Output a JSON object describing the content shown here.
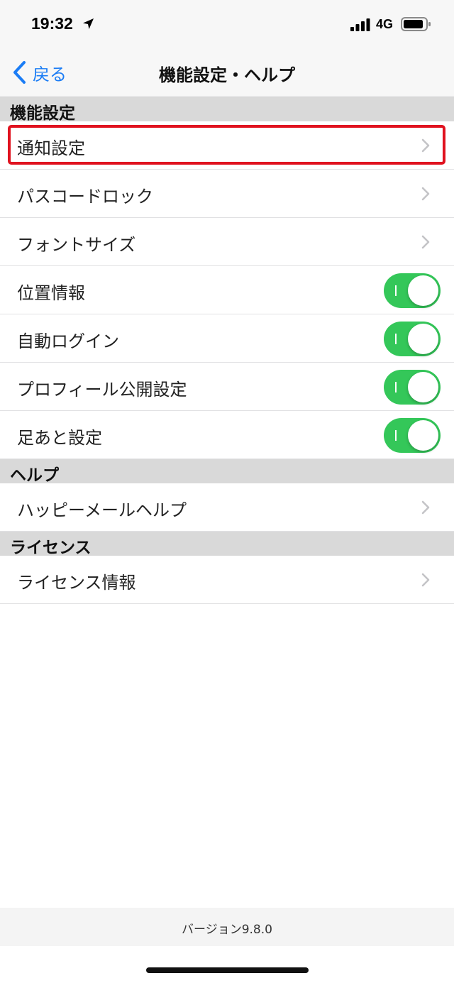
{
  "status_bar": {
    "time": "19:32",
    "network": "4G"
  },
  "nav": {
    "back_label": "戻る",
    "title": "機能設定・ヘルプ"
  },
  "sections": {
    "features": {
      "header": "機能設定",
      "rows": [
        {
          "label": "通知設定",
          "control": "chevron"
        },
        {
          "label": "パスコードロック",
          "control": "chevron"
        },
        {
          "label": "フォントサイズ",
          "control": "chevron"
        },
        {
          "label": "位置情報",
          "control": "toggle",
          "on": true
        },
        {
          "label": "自動ログイン",
          "control": "toggle",
          "on": true
        },
        {
          "label": "プロフィール公開設定",
          "control": "toggle",
          "on": true
        },
        {
          "label": "足あと設定",
          "control": "toggle",
          "on": true
        }
      ]
    },
    "help": {
      "header": "ヘルプ",
      "rows": [
        {
          "label": "ハッピーメールヘルプ",
          "control": "chevron"
        }
      ]
    },
    "license": {
      "header": "ライセンス",
      "rows": [
        {
          "label": "ライセンス情報",
          "control": "chevron"
        }
      ]
    }
  },
  "footer": {
    "version": "バージョン9.8.0"
  },
  "colors": {
    "accent": "#1a7cf5",
    "toggle_on": "#34c759",
    "highlight": "#e0121f",
    "section_bg": "#d9d9d9"
  }
}
